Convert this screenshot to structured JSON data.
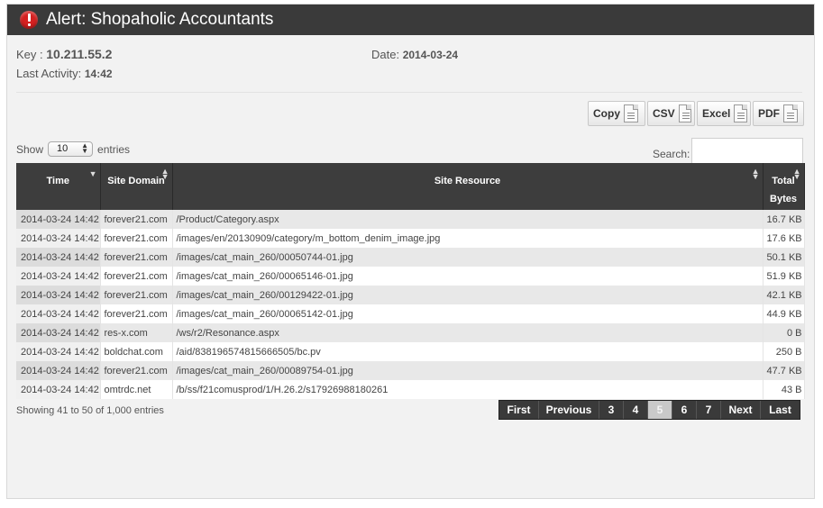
{
  "header": {
    "title": "Alert: Shopaholic Accountants"
  },
  "meta": {
    "key_label": "Key :",
    "key_value": "10.211.55.2",
    "date_label": "Date:",
    "date_value": "2014-03-24",
    "activity_label": "Last Activity:",
    "activity_value": "14:42"
  },
  "export_buttons": [
    {
      "label": "Copy",
      "icon": "copy-icon"
    },
    {
      "label": "CSV",
      "icon": "csv-file-icon"
    },
    {
      "label": "Excel",
      "icon": "excel-file-icon"
    },
    {
      "label": "PDF",
      "icon": "pdf-file-icon"
    }
  ],
  "length": {
    "prefix": "Show",
    "selected": "10",
    "suffix": "entries"
  },
  "search": {
    "label": "Search:",
    "value": ""
  },
  "table": {
    "columns": [
      "Time",
      "Site Domain",
      "Site Resource",
      "Total Bytes"
    ],
    "rows": [
      [
        "2014-03-24 14:42",
        "forever21.com",
        "/Product/Category.aspx",
        "16.7 KB"
      ],
      [
        "2014-03-24 14:42",
        "forever21.com",
        "/images/en/20130909/category/m_bottom_denim_image.jpg",
        "17.6 KB"
      ],
      [
        "2014-03-24 14:42",
        "forever21.com",
        "/images/cat_main_260/00050744-01.jpg",
        "50.1 KB"
      ],
      [
        "2014-03-24 14:42",
        "forever21.com",
        "/images/cat_main_260/00065146-01.jpg",
        "51.9 KB"
      ],
      [
        "2014-03-24 14:42",
        "forever21.com",
        "/images/cat_main_260/00129422-01.jpg",
        "42.1 KB"
      ],
      [
        "2014-03-24 14:42",
        "forever21.com",
        "/images/cat_main_260/00065142-01.jpg",
        "44.9 KB"
      ],
      [
        "2014-03-24 14:42",
        "res-x.com",
        "/ws/r2/Resonance.aspx",
        "0 B"
      ],
      [
        "2014-03-24 14:42",
        "boldchat.com",
        "/aid/838196574815666505/bc.pv",
        "250 B"
      ],
      [
        "2014-03-24 14:42",
        "forever21.com",
        "/images/cat_main_260/00089754-01.jpg",
        "47.7 KB"
      ],
      [
        "2014-03-24 14:42",
        "omtrdc.net",
        "/b/ss/f21comusprod/1/H.26.2/s17926988180261",
        "43 B"
      ]
    ]
  },
  "footer": {
    "info": "Showing 41 to 50 of 1,000 entries"
  },
  "pagination": {
    "buttons": [
      "First",
      "Previous",
      "3",
      "4",
      "5",
      "6",
      "7",
      "Next",
      "Last"
    ],
    "active": "5"
  }
}
